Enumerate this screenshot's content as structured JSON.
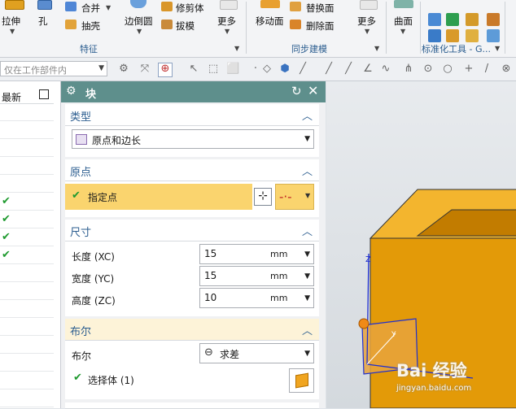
{
  "ribbon": {
    "items": {
      "extrude": "拉伸",
      "hole": "孔",
      "unite": "合并",
      "shell": "抽壳",
      "edge_blend": "边倒圆",
      "trim_body": "修剪体",
      "draft": "拔模",
      "more1": "更多",
      "move_face": "移动面",
      "replace": "替换面",
      "delete_face": "删除面",
      "more2": "更多",
      "surface": "曲面"
    },
    "groups": {
      "feature": "特征",
      "sync": "同步建模",
      "standard": "标准化工具 - G..."
    }
  },
  "filterbar": {
    "filter_value": "仅在工作部件内"
  },
  "left_panel": {
    "header": "最新",
    "checks": [
      false,
      false,
      false,
      false,
      false,
      true,
      true,
      true,
      true,
      false,
      false,
      false,
      false,
      false,
      false,
      false,
      false
    ]
  },
  "dialog": {
    "title": "块",
    "type_section": {
      "title": "类型",
      "value": "原点和边长"
    },
    "origin_section": {
      "title": "原点",
      "specify_point": "指定点"
    },
    "dimensions_section": {
      "title": "尺寸",
      "rows": [
        {
          "label": "长度 (XC)",
          "value": "15",
          "unit": "mm"
        },
        {
          "label": "宽度 (YC)",
          "value": "15",
          "unit": "mm"
        },
        {
          "label": "高度 (ZC)",
          "value": "10",
          "unit": "mm"
        }
      ]
    },
    "boolean_section": {
      "title": "布尔",
      "label": "布尔",
      "value": "求差",
      "select_body": "选择体 (1)"
    }
  },
  "watermark": {
    "main": "Bai 经验",
    "sub": "jingyan.baidu.com"
  },
  "colors": {
    "title_bar": "#5e8f8c",
    "highlight": "#fad46e",
    "section_title": "#2b5d8f",
    "model": "#e9a10c"
  }
}
